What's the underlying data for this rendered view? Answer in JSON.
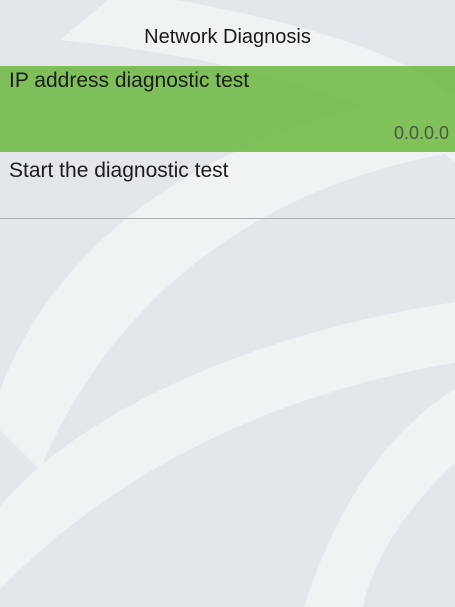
{
  "header": {
    "title": "Network Diagnosis"
  },
  "menu": {
    "items": [
      {
        "label": "IP address diagnostic test",
        "value": "0.0.0.0",
        "selected": true
      },
      {
        "label": "Start the diagnostic test",
        "selected": false
      }
    ]
  },
  "colors": {
    "background": "#e3e7ec",
    "selected_item": "#6eb840",
    "watermark": "#f2f4f6",
    "divider": "#a9adb2"
  }
}
